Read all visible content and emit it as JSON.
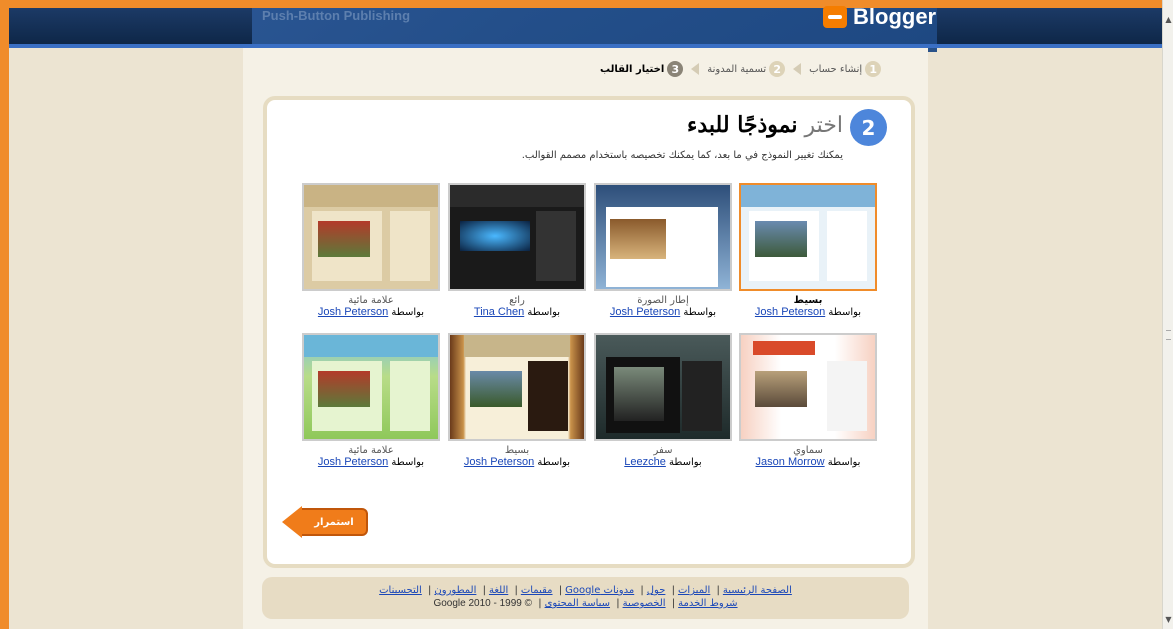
{
  "header": {
    "brand_left": "Push-Button Publishing",
    "logo_text": "Blogger"
  },
  "steps": [
    {
      "num": "1",
      "label": "إنشاء حساب"
    },
    {
      "num": "2",
      "label": "تسمية المدونة"
    },
    {
      "num": "3",
      "label": "اختيار القالب"
    }
  ],
  "main": {
    "step_number": "2",
    "title_light": "اختر",
    "title_bold": "نموذجًا للبدء",
    "subtitle": "يمكنك تغيير النموذج في ما بعد، كما يمكنك تخصيصه باستخدام مصمم القوالب."
  },
  "templates": [
    {
      "name": "بسيط",
      "by": "بواسطة",
      "author": "Josh Peterson"
    },
    {
      "name": "إطار الصورة",
      "by": "بواسطة",
      "author": "Josh Peterson"
    },
    {
      "name": "رائع",
      "by": "بواسطة",
      "author": "Tina Chen"
    },
    {
      "name": "علامة مائية",
      "by": "بواسطة",
      "author": "Josh Peterson"
    },
    {
      "name": "سماوي",
      "by": "بواسطة",
      "author": "Jason Morrow"
    },
    {
      "name": "سفر",
      "by": "بواسطة",
      "author": "Leezche"
    },
    {
      "name": "بسيط",
      "by": "بواسطة",
      "author": "Josh Peterson"
    },
    {
      "name": "علامة مائية",
      "by": "بواسطة",
      "author": "Josh Peterson"
    }
  ],
  "continue_label": "استمرار",
  "footer": {
    "links": [
      "الصفحة الرئيسية",
      "الميزات",
      "حول",
      "مدونات Google",
      "مقيمات",
      "اللغة",
      "المطورون",
      "التحسينات"
    ],
    "links2": [
      "شروط الخدمة",
      "الخصوصية",
      "سياسة المحتوى"
    ],
    "copyright": "© 1999 - 2010 Google"
  },
  "colors": {
    "accent": "#f08c2a",
    "header": "#1c3a66",
    "badge": "#4d86db",
    "link": "#1a47b8"
  }
}
